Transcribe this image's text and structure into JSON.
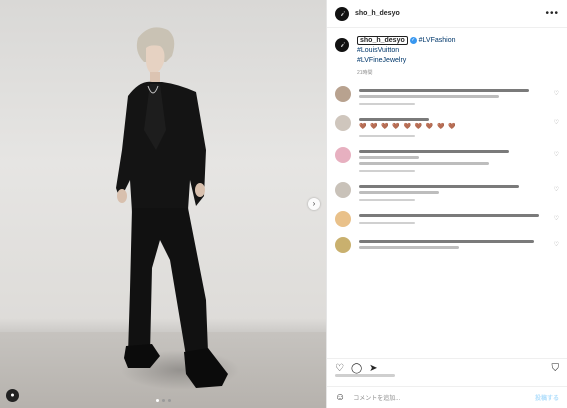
{
  "post": {
    "username": "sho_h_desyo",
    "avatar_letter": "𝒾",
    "verified_mark": "✓",
    "more_icon": "more-horizontal-icon"
  },
  "caption": {
    "username": "sho_h_desyo",
    "tags": [
      "#LVFashion",
      "#LouisVuitton",
      "#LVFineJewelry"
    ],
    "time": "21時間"
  },
  "photo": {
    "next_arrow": "›",
    "tag_icon": "person-tag-icon",
    "carousel_count": 3,
    "active_index": 1
  },
  "comments": [
    {
      "color": "#b8a28f",
      "emoji": ""
    },
    {
      "color": "#cfc6bd",
      "emoji": "🤎 🤎 🤎 🤎 🤎 🤎 🤎 🤎 🤎"
    },
    {
      "color": "#e7b0c0",
      "emoji": ""
    },
    {
      "color": "#c9c2b9",
      "emoji": ""
    },
    {
      "color": "#e9c18a",
      "emoji": ""
    },
    {
      "color": "#c9b06e",
      "emoji": ""
    }
  ],
  "actions": {
    "like": "♡",
    "comment": "💬",
    "share": "➤",
    "save": "⛉",
    "emoji": "☺",
    "placeholder": "コメントを追加...",
    "post_label": "投稿する"
  }
}
